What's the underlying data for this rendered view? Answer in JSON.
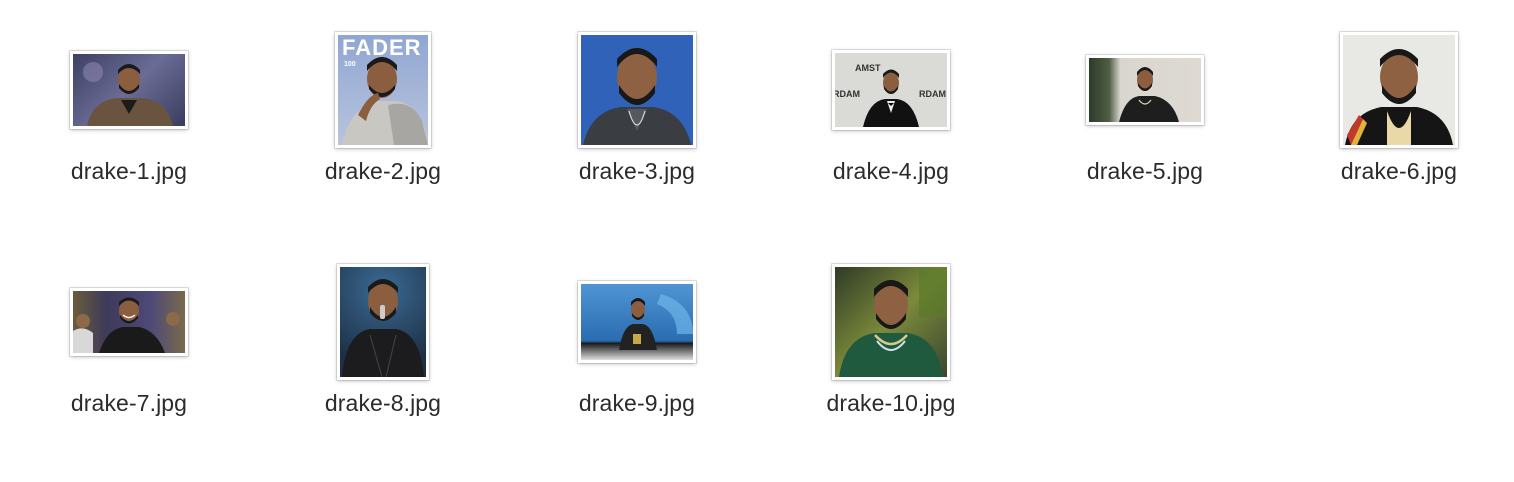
{
  "files": [
    {
      "name": "drake-1.jpg",
      "thumb_icon": "drake-portrait-icon",
      "background": "#5a5f86"
    },
    {
      "name": "drake-2.jpg",
      "thumb_icon": "magazine-cover-icon",
      "background": "#7d96c8",
      "cover_text": "FADER",
      "cover_sub": "100"
    },
    {
      "name": "drake-3.jpg",
      "thumb_icon": "drake-portrait-icon",
      "background": "#2e5fb4"
    },
    {
      "name": "drake-4.jpg",
      "thumb_icon": "drake-portrait-icon",
      "background": "#d9d9d6",
      "sign_left": "AMST",
      "sign_mid_left": "RDAM",
      "sign_mid_right": "RDAM"
    },
    {
      "name": "drake-5.jpg",
      "thumb_icon": "drake-portrait-icon",
      "background": "#dcd8d0"
    },
    {
      "name": "drake-6.jpg",
      "thumb_icon": "drake-portrait-icon",
      "background": "#e6e6e2"
    },
    {
      "name": "drake-7.jpg",
      "thumb_icon": "drake-portrait-icon",
      "background": "#4e4a6e"
    },
    {
      "name": "drake-8.jpg",
      "thumb_icon": "drake-portrait-icon",
      "background": "#2b4866"
    },
    {
      "name": "drake-9.jpg",
      "thumb_icon": "drake-portrait-icon",
      "background": "#3a86c8"
    },
    {
      "name": "drake-10.jpg",
      "thumb_icon": "drake-portrait-icon",
      "background": "#3d4a34"
    }
  ]
}
